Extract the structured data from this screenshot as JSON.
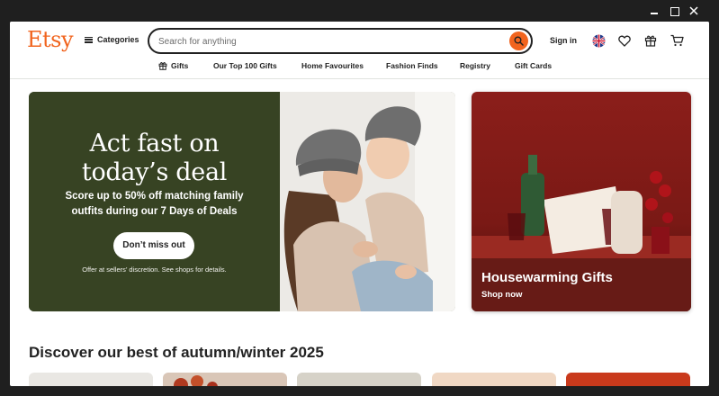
{
  "window": {
    "minimize_icon": "minimize-icon",
    "maximize_icon": "maximize-icon",
    "close_icon": "close-icon"
  },
  "header": {
    "logo": "Etsy",
    "categories_label": "Categories",
    "search_placeholder": "Search for anything",
    "sign_in": "Sign in",
    "icons": [
      "search-icon",
      "flag-icon",
      "heart-icon",
      "gift-icon",
      "cart-icon"
    ]
  },
  "nav": {
    "items": [
      {
        "label": "Gifts",
        "icon": "gift-icon"
      },
      {
        "label": "Our Top 100 Gifts"
      },
      {
        "label": "Home Favourites"
      },
      {
        "label": "Fashion Finds"
      },
      {
        "label": "Registry"
      },
      {
        "label": "Gift Cards"
      }
    ]
  },
  "hero": {
    "title_line1": "Act fast on",
    "title_line2": "today’s deal",
    "subtitle_line1": "Score up to 50% off matching family",
    "subtitle_line2": "outfits during our 7 Days of Deals",
    "cta": "Don’t miss out",
    "fine_print": "Offer at sellers’ discretion. See shops for details."
  },
  "promo": {
    "title": "Housewarming Gifts",
    "link": "Shop now"
  },
  "section": {
    "title": "Discover our best of autumn/winter 2025"
  },
  "colors": {
    "brand": "#f1641e",
    "hero_bg": "#374323",
    "promo_bg": "#8e1f1b"
  }
}
